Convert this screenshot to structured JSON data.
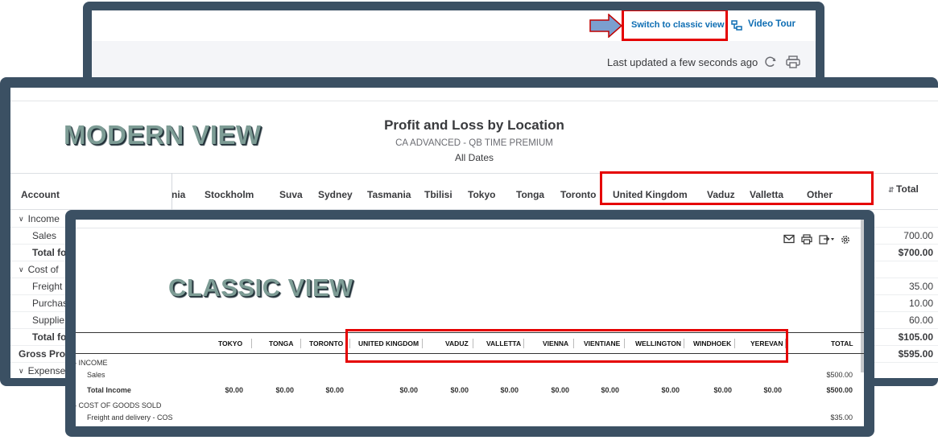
{
  "top_bar": {
    "switch_link": "Switch to classic view",
    "video_link": "Video Tour",
    "last_updated": "Last updated a few seconds ago"
  },
  "modern": {
    "overlay_label": "MODERN VIEW",
    "title": "Profit and Loss by Location",
    "company": "CA ADVANCED - QB TIME PREMIUM",
    "dates": "All Dates",
    "account_header": "Account",
    "columns": [
      "nia",
      "Stockholm",
      "Suva",
      "Sydney",
      "Tasmania",
      "Tbilisi",
      "Tokyo",
      "Tonga",
      "Toronto",
      "United Kingdom",
      "Vaduz",
      "Valletta",
      "Other"
    ],
    "total_header": "Total",
    "rows": [
      {
        "label": "Income",
        "amount": ""
      },
      {
        "label": "Sales",
        "amount": "700.00"
      },
      {
        "label": "Total fo",
        "amount": "$700.00"
      },
      {
        "label": "Cost of",
        "amount": ""
      },
      {
        "label": "Freight a",
        "amount": "35.00"
      },
      {
        "label": "Purchas",
        "amount": "10.00"
      },
      {
        "label": "Supplie",
        "amount": "60.00"
      },
      {
        "label": "Total fo",
        "amount": "$105.00"
      },
      {
        "label": "Gross Profit",
        "amount": "$595.00"
      },
      {
        "label": "Expense",
        "amount": ""
      }
    ]
  },
  "classic": {
    "overlay_label": "CLASSIC VIEW",
    "columns": [
      "TOKYO",
      "TONGA",
      "TORONTO",
      "UNITED KINGDOM",
      "VADUZ",
      "VALLETTA",
      "VIENNA",
      "VIENTIANE",
      "WELLINGTON",
      "WINDHOEK",
      "YEREVAN"
    ],
    "total_header": "TOTAL",
    "rows": {
      "income_label": "INCOME",
      "sales_label": "Sales",
      "sales_total": "$500.00",
      "total_income_label": "Total Income",
      "total_income_values": [
        "$0.00",
        "$0.00",
        "$0.00",
        "$0.00",
        "$0.00",
        "$0.00",
        "$0.00",
        "$0.00",
        "$0.00",
        "$0.00",
        "$0.00"
      ],
      "total_income_total": "$500.00",
      "cogs_label": "COST OF GOODS SOLD",
      "freight_label": "Freight and delivery - COS",
      "freight_total": "$35.00"
    }
  },
  "colors": {
    "frame": "#3b5063",
    "highlight": "#e50000",
    "link": "#0d6db3",
    "overlay_text": "#7d9c95"
  }
}
